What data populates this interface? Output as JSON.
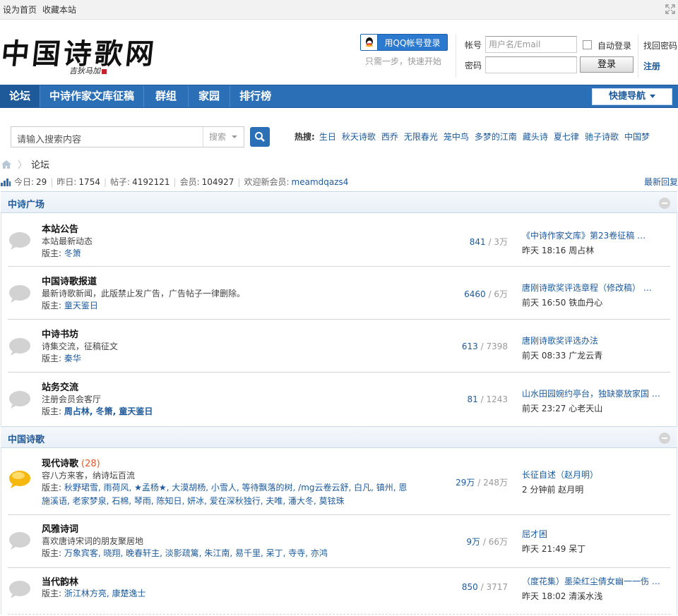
{
  "topbar": {
    "set_home": "设为首页",
    "bookmark": "收藏本站"
  },
  "header": {
    "logo_text": "中国诗歌网",
    "logo_sign": "吉狄马加",
    "qq_login": "用QQ帐号登录",
    "qq_sub": "只需一步，快速开始",
    "account_label": "帐号",
    "account_placeholder": "用户名/Email",
    "password_label": "密码",
    "auto_login": "自动登录",
    "login_button": "登录",
    "find_password": "找回密码",
    "register": "注册"
  },
  "nav": {
    "items": [
      "论坛",
      "中诗作家文库征稿",
      "群组",
      "家园",
      "排行榜"
    ],
    "quick": "快捷导航"
  },
  "search": {
    "placeholder": "请输入搜索内容",
    "type": "搜索",
    "hot_label": "热搜:",
    "hot": [
      "生日",
      "秋天诗歌",
      "西乔",
      "无限春光",
      "笼中鸟",
      "多梦的江南",
      "藏头诗",
      "夏七律",
      "驰子诗歌",
      "中国梦"
    ]
  },
  "breadcrumb": {
    "current": "论坛"
  },
  "stats": {
    "today_label": "今日:",
    "today": "29",
    "yesterday_label": "昨日:",
    "yesterday": "1754",
    "posts_label": "帖子:",
    "posts": "4192121",
    "members_label": "会员:",
    "members": "104927",
    "welcome_label": "欢迎新会员:",
    "newmember": "meamdqazs4",
    "latest": "最新回复"
  },
  "sections": [
    {
      "title": "中诗广场",
      "forums": [
        {
          "name": "本站公告",
          "desc": "本站最新动态",
          "mod_label": "版主:",
          "mods": "冬箫",
          "mods_bold": false,
          "threads": "841",
          "posts": "3万",
          "last_title": "《中诗作家文库》第23卷征稿 …",
          "last_time": "昨天 18:16 周占林"
        },
        {
          "name": "中国诗歌报道",
          "desc": "最新诗歌新闻，此版禁止发广告，广告帖子一律删除。",
          "mod_label": "版主:",
          "mods": "童天鉴日",
          "mods_bold": false,
          "threads": "6460",
          "posts": "6万",
          "last_title": "唐刚诗歌奖评选章程（修改稿） …",
          "last_time": "前天 16:50 铁血丹心"
        },
        {
          "name": "中诗书坊",
          "desc": "诗集交流，征稿征文",
          "mod_label": "版主:",
          "mods": "秦华",
          "mods_bold": false,
          "threads": "613",
          "posts": "7398",
          "last_title": "唐刚诗歌奖评选办法",
          "last_time": "前天 08:33 广龙云青"
        },
        {
          "name": "站务交流",
          "desc": "注册会员会客厅",
          "mod_label": "版主:",
          "mods": "周占林, 冬箫, 童天鉴日",
          "mods_bold": true,
          "threads": "81",
          "posts": "1243",
          "last_title": "山水田园婉约亭台，独缺豪放家国 …",
          "last_time": "前天 23:27 心老天山"
        }
      ]
    },
    {
      "title": "中国诗歌",
      "forums": [
        {
          "name": "现代诗歌",
          "today": "(28)",
          "desc": "容八方来客，纳诗坛百流",
          "mod_label": "版主:",
          "mods": "秋野珺雪, 雨荷风, ★孟杨★, 大漠胡杨, 小雪人, 等待飘落的树, /mg云卷云舒, 白凡, 镇州, 恩施溪语, 老家梦泉, 石棉, 琴雨, 陈知日, 妍冰, 爱在深秋独行, 夫唯, 潘大冬, 莫铉珠",
          "mods_bold": false,
          "threads": "29万",
          "posts": "248万",
          "last_title": "长征自述（赵月明）",
          "last_time": "2 分钟前 赵月明",
          "active": true
        },
        {
          "name": "风雅诗词",
          "desc": "喜欢唐诗宋词的朋友聚居地",
          "mod_label": "版主:",
          "mods": "万象宾客, 晓翔, 晚春轩主, 淡影疏篱, 朱江南, 易千里, 呆丁, 寺寺, 亦鸿",
          "mods_bold": false,
          "threads": "9万",
          "posts": "66万",
          "last_title": "屈才困",
          "last_time": "昨天 21:49 呆丁"
        },
        {
          "name": "当代韵林",
          "desc": "",
          "mod_label": "版主:",
          "mods": "浙江林方亮, 康楚逸士",
          "mods_bold": false,
          "threads": "850",
          "posts": "3717",
          "last_title": "（度花集）墨染红尘倩女幽一一伤 …",
          "last_time": "昨天 18:02 清溪水浅"
        }
      ]
    }
  ]
}
